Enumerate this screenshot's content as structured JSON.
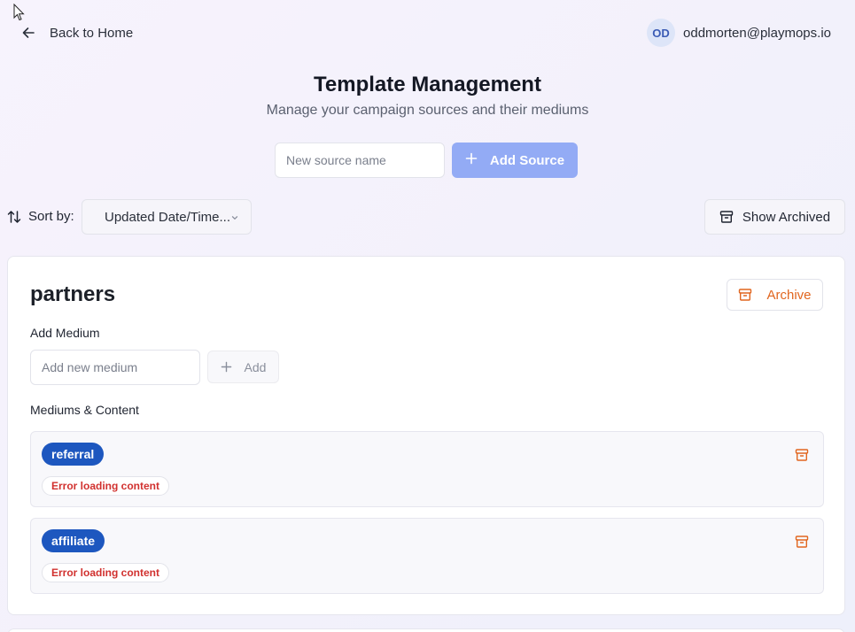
{
  "header": {
    "back_label": "Back to Home",
    "user_initials": "OD",
    "user_email": "oddmorten@playmops.io"
  },
  "page": {
    "title": "Template Management",
    "subtitle": "Manage your campaign sources and their mediums"
  },
  "new_source": {
    "placeholder": "New source name",
    "button_label": "Add Source"
  },
  "sort": {
    "label": "Sort by:",
    "selected": "Updated Date/Time..."
  },
  "show_archived_label": "Show Archived",
  "source_card": {
    "name": "partners",
    "archive_label": "Archive",
    "add_medium_label": "Add Medium",
    "medium_placeholder": "Add new medium",
    "add_button_label": "Add",
    "mediums_heading": "Mediums & Content",
    "mediums": [
      {
        "name": "referral",
        "status": "Error loading content"
      },
      {
        "name": "affiliate",
        "status": "Error loading content"
      }
    ]
  },
  "colors": {
    "primary_disabled": "#93abf5",
    "pill": "#1d57bf",
    "archive_accent": "#e1661f",
    "error": "#d1312f"
  },
  "icons": [
    "cursor-icon",
    "arrow-left-icon",
    "plus-icon",
    "sort-arrows-icon",
    "chevron-down-icon",
    "archive-box-icon"
  ]
}
